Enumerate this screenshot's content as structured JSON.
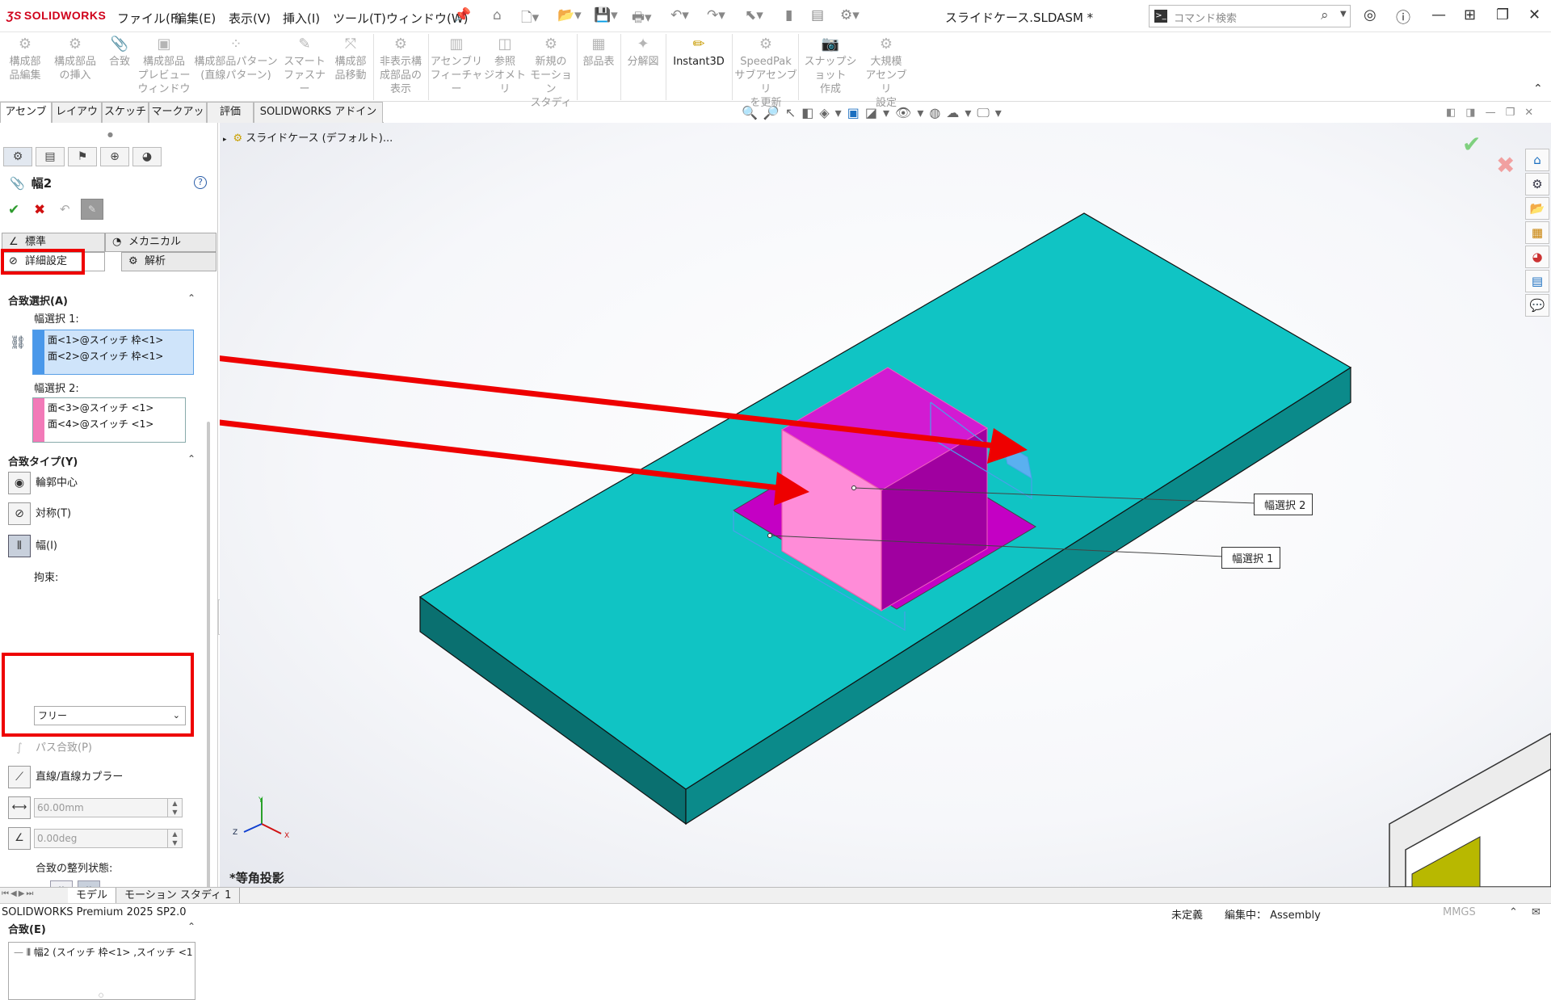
{
  "app": {
    "brand": "SOLIDWORKS",
    "doc_title": "スライドケース.SLDASM *",
    "search_placeholder": "コマンド検索"
  },
  "menu": [
    "ファイル(F)",
    "編集(E)",
    "表示(V)",
    "挿入(I)",
    "ツール(T)",
    "ウィンドウ(W)"
  ],
  "ribbon": [
    {
      "label": "構成部\n品編集",
      "icon": "edit-component-icon"
    },
    {
      "label": "構成部品\nの挿入",
      "icon": "insert-components-icon"
    },
    {
      "label": "合致",
      "icon": "mate-icon"
    },
    {
      "label": "構成部品\nプレビュー\nウィンドウ",
      "icon": "preview-window-icon"
    },
    {
      "label": "構成部品パターン\n(直線パターン)",
      "icon": "linear-pattern-icon"
    },
    {
      "label": "スマート\nファスナー",
      "icon": "smart-fastener-icon"
    },
    {
      "label": "構成部\n品移動",
      "icon": "move-component-icon"
    },
    {
      "label": "非表示構\n成部品の\n表示",
      "icon": "show-hidden-icon"
    },
    {
      "label": "アセンブリ\nフィーチャー",
      "icon": "assembly-feature-icon"
    },
    {
      "label": "参照\nジオメトリ",
      "icon": "reference-geometry-icon"
    },
    {
      "label": "新規の\nモーション\nスタディ",
      "icon": "motion-study-icon"
    },
    {
      "label": "部品表",
      "icon": "bom-icon"
    },
    {
      "label": "分解図",
      "icon": "exploded-view-icon"
    },
    {
      "label": "Instant3D",
      "icon": "instant3d-icon"
    },
    {
      "label": "SpeedPak\nサブアセンブリ\nを更新",
      "icon": "speedpak-icon"
    },
    {
      "label": "スナップショット\n作成",
      "icon": "snapshot-icon"
    },
    {
      "label": "大規模\nアセンブリ\n設定",
      "icon": "large-assembly-icon"
    }
  ],
  "cmd_tabs": [
    "アセンブリ",
    "レイアウト",
    "スケッチ",
    "マークアップ",
    "評価",
    "SOLIDWORKS アドイン"
  ],
  "tree": {
    "root": "スライドケース (デフォルト)..."
  },
  "pm": {
    "title": "幅2",
    "tabs": {
      "standard": "標準",
      "mechanical": "メカニカル",
      "advanced": "詳細設定",
      "analysis": "解析"
    },
    "sel_title": "合致選択(A)",
    "w1_label": "幅選択 1:",
    "w1": [
      "面<1>@スイッチ 枠<1>",
      "面<2>@スイッチ 枠<1>"
    ],
    "w2_label": "幅選択 2:",
    "w2": [
      "面<3>@スイッチ <1>",
      "面<4>@スイッチ <1>"
    ],
    "type_title": "合致タイプ(Y)",
    "types": {
      "profile": "輪郭中心",
      "symmetric": "対称(T)",
      "width": "幅(I)",
      "path": "パス合致(P)",
      "coupler": "直線/直線カプラー"
    },
    "constraint_label": "拘束:",
    "constraint": "フリー",
    "distance": "60.00mm",
    "angle": "0.00deg",
    "align_label": "合致の整列状態:",
    "mates_title": "合致(E)",
    "mate_item": "幅2 (スイッチ 枠<1> ,スイッチ <1"
  },
  "viewport": {
    "callout1": "幅選択 1",
    "callout2": "幅選択 2",
    "view_label": "*等角投影",
    "axes": [
      "Y",
      "Z",
      "X"
    ]
  },
  "bottom_tabs": [
    "モデル",
    "モーション スタディ 1"
  ],
  "status": {
    "product": "SOLIDWORKS Premium 2025 SP2.0",
    "state": "未定義",
    "editing": "編集中： Assembly",
    "units": "MMGS"
  },
  "colors": {
    "plate_top": "#10c4c4",
    "plate_side": "#0b8a8a",
    "slider_top": "#c800c8",
    "slider_face": "#ff90dc",
    "accent_red": "#ee0000"
  }
}
